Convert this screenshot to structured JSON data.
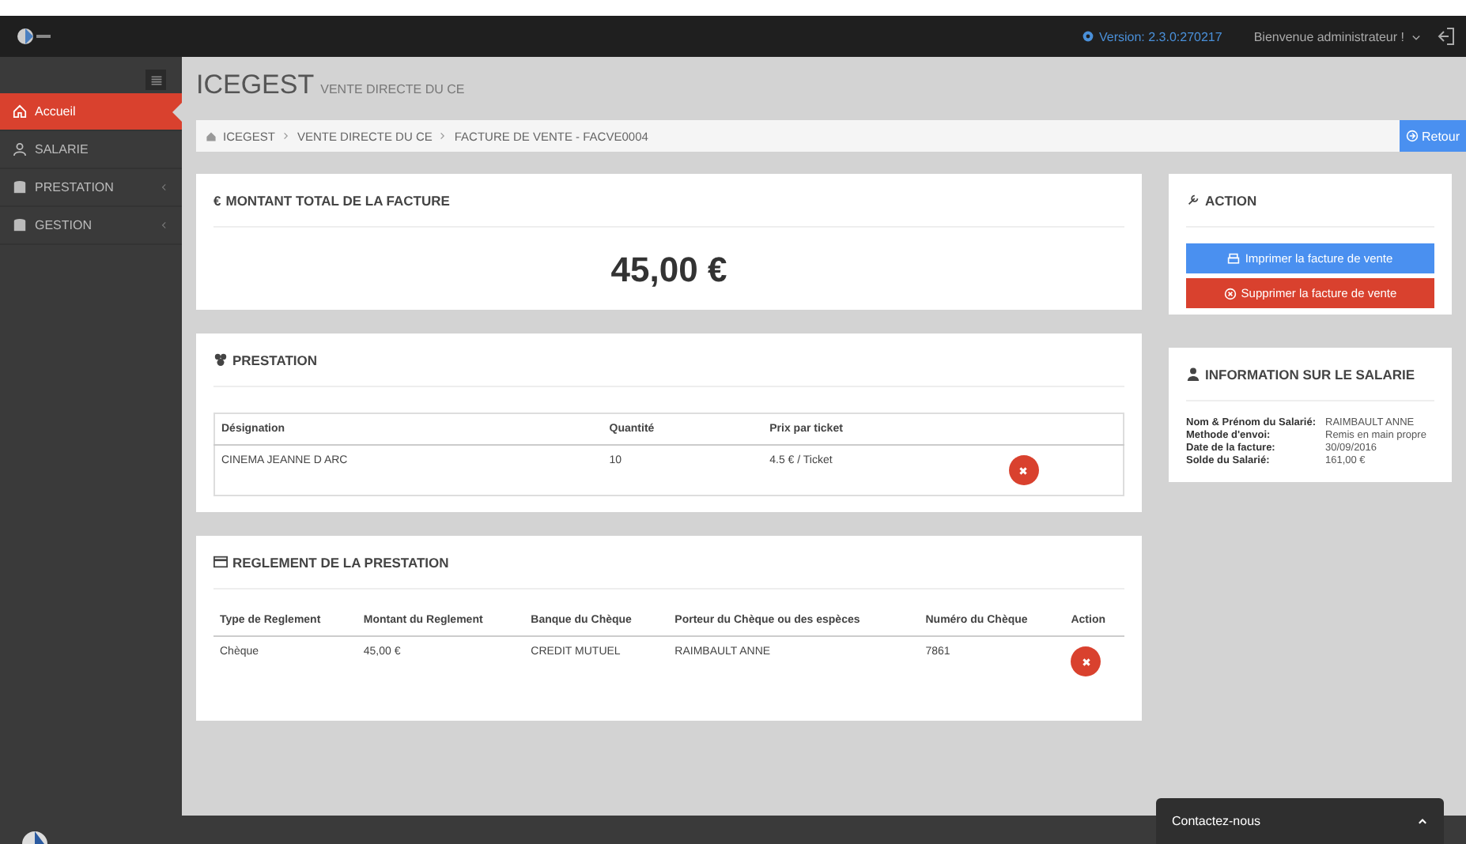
{
  "top_bar": {
    "version": "Version: 2.3.0:270217",
    "user_menu": "Bienvenue administrateur !"
  },
  "sidebar": {
    "items": [
      {
        "label": "Accueil",
        "kind": "home",
        "selected": true,
        "has_submenu": false
      },
      {
        "label": "SALARIE",
        "kind": "user",
        "selected": false,
        "has_submenu": false
      },
      {
        "label": "PRESTATION",
        "kind": "database",
        "selected": false,
        "has_submenu": true
      },
      {
        "label": "GESTION",
        "kind": "database",
        "selected": false,
        "has_submenu": true
      }
    ]
  },
  "page": {
    "title": "ICEGEST",
    "subtitle": "VENTE DIRECTE DU CE"
  },
  "breadcrumb": {
    "items": [
      "ICEGEST",
      "VENTE DIRECTE DU CE",
      "FACTURE DE VENTE - FACVE0004"
    ],
    "back_button": "Retour"
  },
  "total": {
    "symbol": "€",
    "title": "MONTANT TOTAL DE LA FACTURE",
    "amount": "45,00 €"
  },
  "prestation": {
    "title": "PRESTATION",
    "columns": [
      "Désignation",
      "Quantité",
      "Prix par ticket"
    ],
    "rows": [
      {
        "cells": [
          "CINEMA JEANNE D ARC",
          "10",
          "4.5 € / Ticket"
        ]
      }
    ]
  },
  "reglement": {
    "title": "REGLEMENT DE LA PRESTATION",
    "columns": [
      "Type de Reglement",
      "Montant du Reglement",
      "Banque du Chèque",
      "Porteur du Chèque ou des espèces",
      "Numéro du Chèque",
      "Action"
    ],
    "rows": [
      {
        "cells": [
          "Chèque",
          "45,00 €",
          "CREDIT MUTUEL",
          "RAIMBAULT ANNE",
          "7861"
        ]
      }
    ]
  },
  "action": {
    "title": "ACTION",
    "buttons": [
      {
        "label": "Imprimer la facture de vente",
        "kind": "print"
      },
      {
        "label": "Supprimer la facture de vente",
        "kind": "delete"
      }
    ]
  },
  "salarie": {
    "title": "INFORMATION SUR LE SALARIE",
    "fields": [
      {
        "label": "Nom & Prénom du Salarié:",
        "value": "RAIMBAULT ANNE"
      },
      {
        "label": "Methode d'envoi:",
        "value": "Remis en main propre"
      },
      {
        "label": "Date de la facture:",
        "value": "30/09/2016"
      },
      {
        "label": "Solde du Salarié:",
        "value": "161,00 €"
      }
    ]
  },
  "contact": {
    "label": "Contactez-nous"
  }
}
